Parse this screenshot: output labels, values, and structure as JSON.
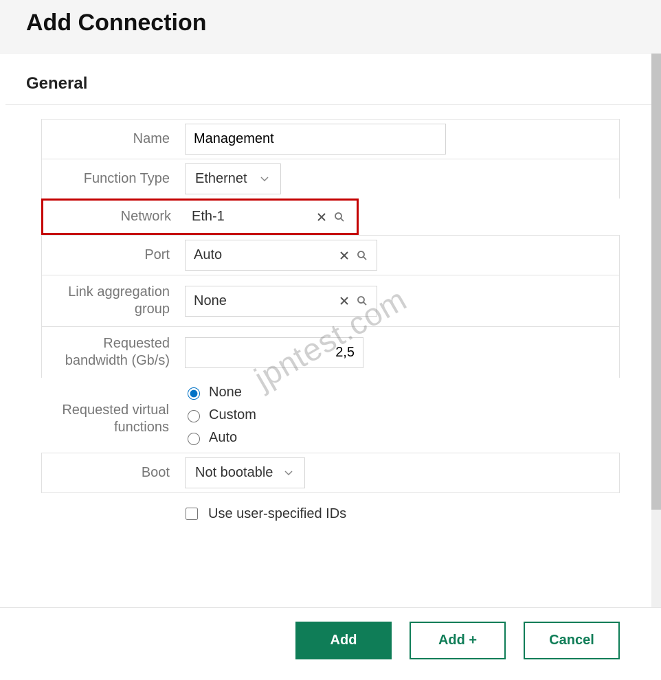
{
  "header": {
    "title": "Add Connection"
  },
  "section": {
    "heading": "General"
  },
  "form": {
    "name": {
      "label": "Name",
      "value": "Management"
    },
    "functype": {
      "label": "Function Type",
      "value": "Ethernet"
    },
    "network": {
      "label": "Network",
      "value": "Eth-1"
    },
    "port": {
      "label": "Port",
      "value": "Auto"
    },
    "lag": {
      "label1": "Link aggregation",
      "label2": "group",
      "value": "None"
    },
    "bandwidth": {
      "label1": "Requested",
      "label2": "bandwidth (Gb/s)",
      "value": "2,5"
    },
    "vf": {
      "label1": "Requested virtual",
      "label2": "functions",
      "options": {
        "none": "None",
        "custom": "Custom",
        "auto": "Auto"
      },
      "selected": "none"
    },
    "boot": {
      "label": "Boot",
      "value": "Not bootable"
    },
    "use_ids": {
      "label": "Use user-specified IDs",
      "checked": false
    }
  },
  "footer": {
    "add": "Add",
    "add_plus": "Add +",
    "cancel": "Cancel"
  },
  "watermark": "jpntest.com"
}
